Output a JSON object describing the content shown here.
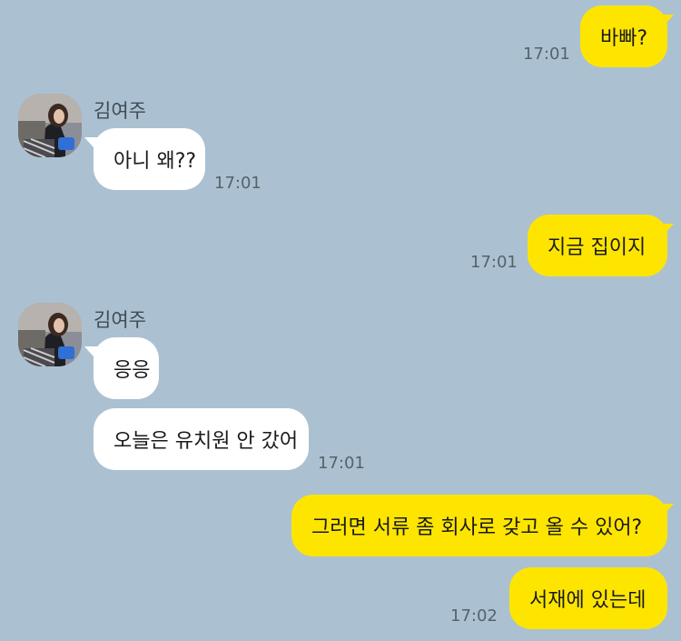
{
  "chat": {
    "messages": [
      {
        "side": "me",
        "text": "바빠?",
        "time": "17:01"
      },
      {
        "side": "other",
        "sender": "김여주",
        "text": "아니 왜??",
        "time": "17:01"
      },
      {
        "side": "me",
        "text": "지금 집이지",
        "time": "17:01"
      },
      {
        "side": "other",
        "sender": "김여주",
        "text": "응응"
      },
      {
        "side": "other",
        "text": "오늘은 유치원 안 갔어",
        "time": "17:01"
      },
      {
        "side": "me",
        "text": "그러면 서류 좀 회사로 갖고 올 수 있어?"
      },
      {
        "side": "me",
        "text": "서재에 있는데",
        "time": "17:02"
      }
    ]
  },
  "colors": {
    "background": "#abc1d1",
    "my_bubble": "#fee500",
    "other_bubble": "#ffffff",
    "time_text": "#56626c"
  }
}
